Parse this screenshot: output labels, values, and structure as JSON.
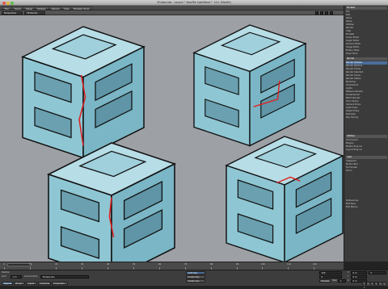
{
  "window": {
    "title": "3Cubes.lws - Layout™ NewTek LightWave™ 10.1 (Mac64)",
    "modeler_label": "Modeler"
  },
  "menu": [
    "File",
    "Items",
    "Setup",
    "Utilities",
    "Render",
    "View",
    "Modeler Tools"
  ],
  "viewbar": {
    "view_mode": "Perspective",
    "shading": "VR Render"
  },
  "sidebar": {
    "top_items": [
      "File",
      "Edit",
      "Items",
      "Setup",
      "Utilities",
      "Render",
      "View",
      "Modeler",
      "Scene Editor",
      "Graph Editor",
      "Surface Editor",
      "Image Editor",
      "Motion Mixer",
      "Dope Track"
    ],
    "section_label": "Render",
    "render_items": [
      "Render Globals",
      "Render Options",
      "Render Frame",
      "Render Selected",
      "Render Scene",
      "Render Status",
      "Backdrop",
      "Volumetrics",
      "Lights",
      "Network Render",
      "Screamernet",
      "Batch Render",
      "Color Space",
      "Camera Props",
      "Light Props",
      "Object Props",
      "Radiosity",
      "Ray Tracing"
    ],
    "section2_label": "Utilities",
    "util_items": [
      "Commands",
      "Plugins",
      "Master Plug-ins",
      "Layout Plug-ins"
    ],
    "section3_label": "View",
    "view_items": [
      "Viewports",
      "Motion Blur",
      "Full Screen",
      "Zoom"
    ],
    "bottom_items": [
      "Preferences",
      "Edit Keys",
      "Edit Menus"
    ],
    "selected": "Render Globals"
  },
  "timeline": {
    "ticks": [
      "0",
      "10",
      "20",
      "30",
      "40",
      "50",
      "60",
      "70",
      "80",
      "90",
      "100",
      "110",
      "120"
    ]
  },
  "bottombar": {
    "position_label": "Position",
    "x_value": "0 m",
    "y_value": "0 m",
    "z_value": "0 m",
    "grid_label": "Grid",
    "grid_value": "1 m",
    "current_item_label": "Current Item",
    "current_item": "3Cubes.lwo",
    "bones_btn": "Bones",
    "lights_btn": "Lights",
    "cameras_btn": "Cameras",
    "properties_btn": "Properties",
    "objects_btn": "Objects",
    "auto_key": "Auto Key",
    "create_key": "Create Key",
    "delete_key": "Delete Key",
    "preview": "Preview",
    "step_label": "Step",
    "step_value": "1",
    "frame_start": "0",
    "frame_end": "120",
    "frame_current": "0",
    "play_buttons": [
      "|<",
      "<<",
      "<",
      ">",
      ">>",
      ">|"
    ]
  },
  "colors": {
    "viewport_bg": "#9da0a5",
    "cube_face": "#8fc6d3",
    "cube_top": "#b7dde6",
    "cube_dark": "#6aa0b0",
    "accent_red": "#e02020",
    "ui_blue": "#4b6e9a"
  }
}
